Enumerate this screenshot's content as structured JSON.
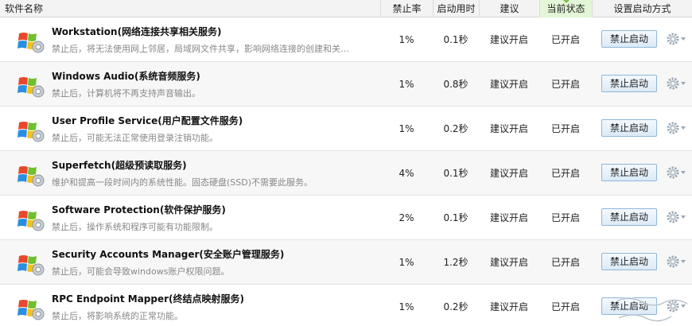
{
  "header": {
    "name": "软件名称",
    "rate": "禁止率",
    "time": "启动用时",
    "suggest": "建议",
    "status": "当前状态",
    "method": "设置启动方式"
  },
  "colors": {
    "header_bg": "#f3f3f3",
    "active_header_bg": "#e3f6d7",
    "button_border": "#8fb6d8",
    "row_alt_bg": "#f7f7f7"
  },
  "rows": [
    {
      "name": "Workstation(网络连接共享相关服务)",
      "desc": "禁止后，将无法使用网上邻居，局域网文件共享，影响网络连接的创建和关…",
      "rate": "1%",
      "time": "0.1秒",
      "suggest": "建议开启",
      "status": "已开启",
      "button": "禁止启动"
    },
    {
      "name": "Windows Audio(系统音频服务)",
      "desc": "禁止后，计算机将不再支持声音输出。",
      "rate": "1%",
      "time": "0.8秒",
      "suggest": "建议开启",
      "status": "已开启",
      "button": "禁止启动"
    },
    {
      "name": "User Profile Service(用户配置文件服务)",
      "desc": "禁止后，可能无法正常使用登录注销功能。",
      "rate": "1%",
      "time": "0.2秒",
      "suggest": "建议开启",
      "status": "已开启",
      "button": "禁止启动"
    },
    {
      "name": "Superfetch(超级预读取服务)",
      "desc": "维护和提高一段时间内的系统性能。固态硬盘(SSD)不需要此服务。",
      "rate": "4%",
      "time": "0.1秒",
      "suggest": "建议开启",
      "status": "已开启",
      "button": "禁止启动"
    },
    {
      "name": "Software Protection(软件保护服务)",
      "desc": "禁止后，操作系统和程序可能有功能限制。",
      "rate": "2%",
      "time": "0.1秒",
      "suggest": "建议开启",
      "status": "已开启",
      "button": "禁止启动"
    },
    {
      "name": "Security Accounts Manager(安全账户管理服务)",
      "desc": "禁止后，可能会导致windows账户权限问题。",
      "rate": "1%",
      "time": "1.2秒",
      "suggest": "建议开启",
      "status": "已开启",
      "button": "禁止启动"
    },
    {
      "name": "RPC Endpoint Mapper(终结点映射服务)",
      "desc": "禁止后，将影响系统的正常功能。",
      "rate": "1%",
      "time": "0.2秒",
      "suggest": "建议开启",
      "status": "已开启",
      "button": "禁止启动"
    }
  ]
}
